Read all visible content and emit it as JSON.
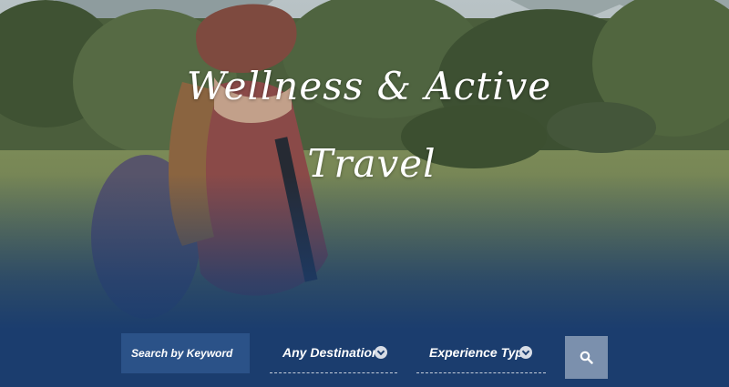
{
  "hero": {
    "title_line1": "Wellness & Active",
    "title_line2": "Travel"
  },
  "search": {
    "keyword_placeholder": "Search by Keyword",
    "destination_label": "Any Destination",
    "experience_label": "Experience Type",
    "submit_icon": "search-icon"
  },
  "colors": {
    "navy": "#1b3d6e",
    "keyword_bg": "#2b5288",
    "button_bg": "#7b90ad"
  }
}
